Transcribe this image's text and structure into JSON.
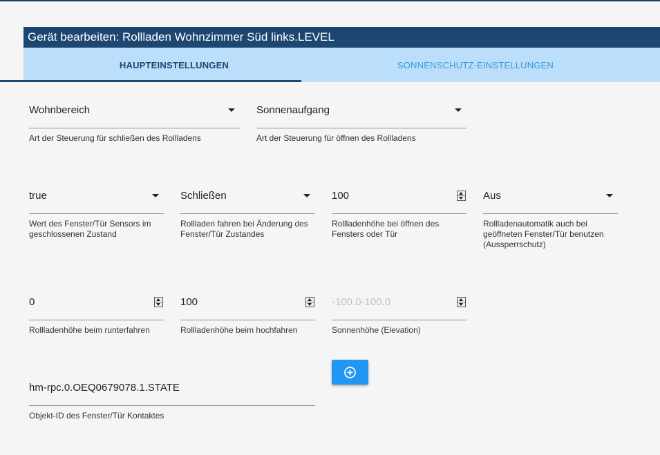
{
  "dialog": {
    "title": "Gerät bearbeiten: Rollladen Wohnzimmer Süd links.LEVEL"
  },
  "tabs": [
    {
      "label": "HAUPTEINSTELLUNGEN",
      "active": true
    },
    {
      "label": "SONNENSCHUTZ-EINSTELLUNGEN",
      "active": false
    }
  ],
  "fields": {
    "close_mode": {
      "value": "Wohnbereich",
      "helper": "Art der Steuerung für schließen des Rollladens"
    },
    "open_mode": {
      "value": "Sonnenaufgang",
      "helper": "Art der Steuerung für öffnen des Rollladens"
    },
    "sensor_value": {
      "value": "true",
      "helper": "Wert des Fenster/Tür Sensors im geschlossenen Zustand"
    },
    "on_change": {
      "value": "Schließen",
      "helper": "Rollladen fahren bei Änderung des Fenster/Tür Zustandes"
    },
    "height_open_window": {
      "value": "100",
      "helper": "Rollladenhöhe bei öffnen des Fensters oder Tür"
    },
    "lockout_protection": {
      "value": "Aus",
      "helper": "Rollladenautomatik auch bei geöffneten Fenster/Tür benutzen (Aussperrschutz)"
    },
    "height_down": {
      "value": "0",
      "helper": "Rollladenhöhe beim runterfahren"
    },
    "height_up": {
      "value": "100",
      "helper": "Rollladenhöhe beim hochfahren"
    },
    "sun_elevation": {
      "placeholder": "-100.0-100.0",
      "helper": "Sonnenhöhe (Elevation)"
    },
    "object_id": {
      "value": "hm-rpc.0.OEQ0679078.1.STATE",
      "helper": "Objekt-ID des Fenster/Tür Kontaktes"
    }
  },
  "icons": {
    "add": "add-circle-icon",
    "dropdown": "caret-down-icon",
    "spinner": "number-spinner-icon"
  },
  "colors": {
    "header_bg": "#1d4771",
    "tabs_bg": "#bbdefb",
    "active_tab_text": "#1d4771",
    "inactive_tab_text": "#3a9ad9",
    "button_bg": "#2196f3"
  }
}
